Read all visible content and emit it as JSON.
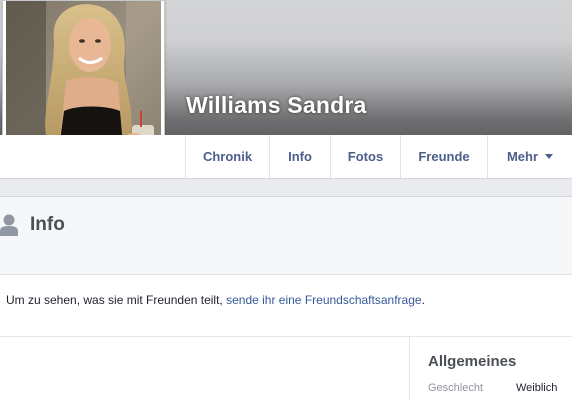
{
  "profile": {
    "name": "Williams Sandra"
  },
  "tabs": [
    {
      "label": "Chronik"
    },
    {
      "label": "Info"
    },
    {
      "label": "Fotos"
    },
    {
      "label": "Freunde"
    },
    {
      "label": "Mehr",
      "icon": "caret-down-icon"
    }
  ],
  "info_section": {
    "title": "Info",
    "icon": "person-icon"
  },
  "notice": {
    "text": "Um zu sehen, was sie mit Freunden teilt, ",
    "link": "sende ihr eine Freundschaftsanfrage",
    "suffix": "."
  },
  "sidebar": {
    "title": "Allgemeines",
    "rows": [
      {
        "label": "Geschlecht",
        "value": "Weiblich"
      }
    ]
  },
  "colors": {
    "link": "#365899",
    "tab_text": "#4b5f8a",
    "page_gray": "#e9ebee"
  }
}
